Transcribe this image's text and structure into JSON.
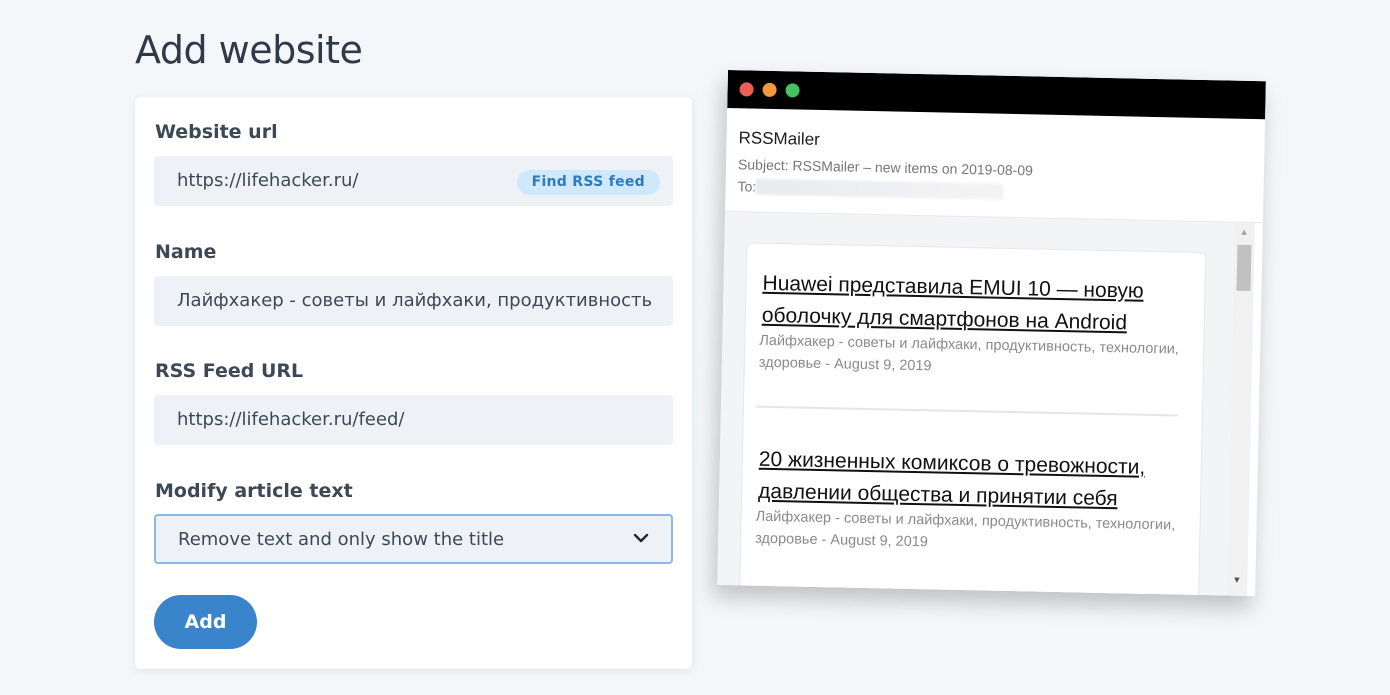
{
  "page": {
    "title": "Add website"
  },
  "form": {
    "website_url": {
      "label": "Website url",
      "value": "https://lifehacker.ru/",
      "find_button": "Find RSS feed"
    },
    "name": {
      "label": "Name",
      "value": "Лайфхакер - советы и лайфхаки, продуктивность, технологии, здоровье"
    },
    "rss_feed_url": {
      "label": "RSS Feed URL",
      "value": "https://lifehacker.ru/feed/"
    },
    "modify_text": {
      "label": "Modify article text",
      "selected": "Remove text and only show the title"
    },
    "submit_label": "Add"
  },
  "email_preview": {
    "sender": "RSSMailer",
    "subject": "Subject: RSSMailer – new items on 2019-08-09",
    "to_label": "To:",
    "articles": [
      {
        "title": "Huawei представила EMUI 10 — новую оболочку для смартфонов на Android",
        "meta": "Лайфхакер - советы и лайфхаки, продуктивность, технологии, здоровье - August 9, 2019"
      },
      {
        "title": "20 жизненных комиксов о тревожности, давлении общества и принятии себя",
        "meta": "Лайфхакер - советы и лайфхаки, продуктивность, технологии, здоровье - August 9, 2019"
      }
    ]
  },
  "colors": {
    "accent": "#3a84cc",
    "badge_bg": "#cfe8fb",
    "input_bg": "#eef2f6"
  },
  "icons": {
    "select_arrow": "chevron-down-icon"
  }
}
